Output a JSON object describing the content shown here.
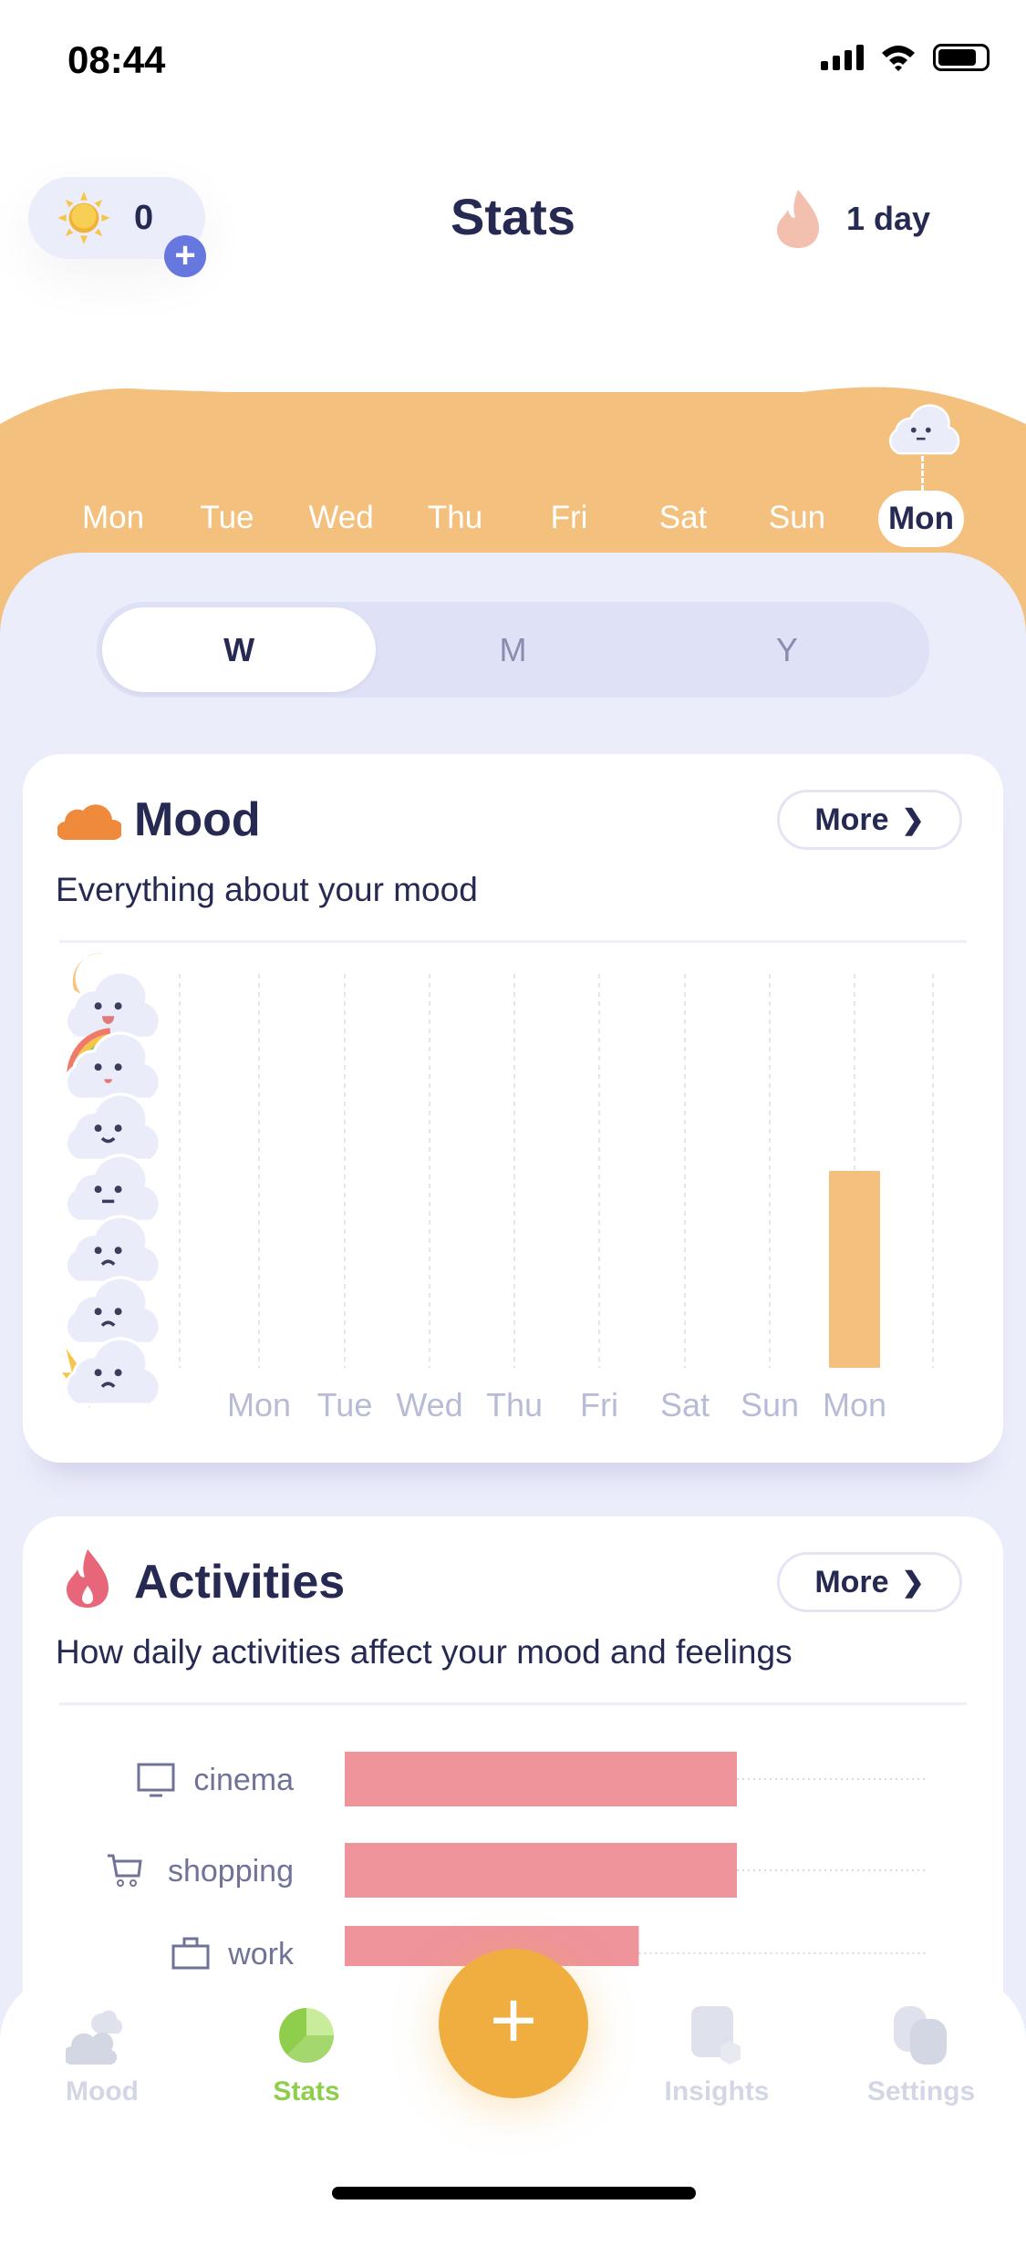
{
  "status_bar": {
    "time": "08:44"
  },
  "header": {
    "title": "Stats",
    "sun_count": "0",
    "streak_label": "1 day"
  },
  "week_strip": {
    "days": [
      "Mon",
      "Tue",
      "Wed",
      "Thu",
      "Fri",
      "Sat",
      "Sun",
      "Mon"
    ],
    "selected_index": 7,
    "selected_mood_level": 4
  },
  "period_tabs": {
    "items": [
      "W",
      "M",
      "Y"
    ],
    "active": "W"
  },
  "mood_card": {
    "title": "Mood",
    "subtitle": "Everything about your mood",
    "more_label": "More",
    "chart_data": {
      "type": "bar",
      "categories": [
        "Mon",
        "Tue",
        "Wed",
        "Thu",
        "Fri",
        "Sat",
        "Sun",
        "Mon"
      ],
      "values": [
        null,
        null,
        null,
        null,
        null,
        null,
        null,
        4
      ],
      "ylim": [
        1,
        7
      ],
      "y_axis": "mood level icons (1 = awful/thunder, 7 = rad/sun)",
      "grid": "vertical dashed",
      "color": "#f4c07e"
    }
  },
  "activities_card": {
    "title": "Activities",
    "subtitle": "How daily activities affect your mood and feelings",
    "more_label": "More",
    "chart_data": {
      "type": "bar",
      "orientation": "horizontal",
      "categories": [
        "cinema",
        "shopping",
        "work"
      ],
      "icons": [
        "monitor-icon",
        "cart-icon",
        "briefcase-icon"
      ],
      "values": [
        1,
        1,
        0.75
      ],
      "color": "#ef949b"
    }
  },
  "nav": {
    "items": [
      {
        "label": "Mood",
        "icon": "cloud-icon"
      },
      {
        "label": "Stats",
        "icon": "pie-icon",
        "active": true
      },
      {
        "label": "Insights",
        "icon": "insights-icon"
      },
      {
        "label": "Settings",
        "icon": "settings-icon"
      }
    ],
    "fab": "+"
  },
  "colors": {
    "accent_orange": "#f1ae40",
    "wave": "#f4c07e",
    "text": "#262a52",
    "active_nav": "#8fce4c",
    "plus_badge": "#6678de"
  }
}
